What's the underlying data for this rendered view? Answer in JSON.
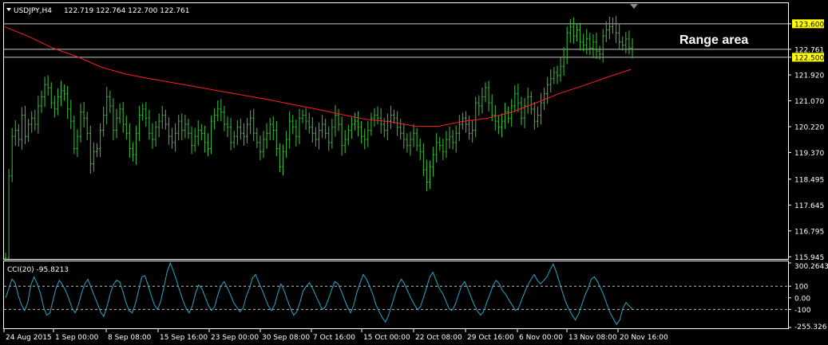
{
  "header": {
    "symbol_label": "USDJPY,H4",
    "ohlc": "122.719 122.764 122.700 122.761"
  },
  "cci_panel": {
    "label": "CCI(20) -95.8213"
  },
  "colors": {
    "background": "#000000",
    "candles": "#3fbf3f",
    "moving_average": "#ff2020",
    "cci": "#2aa7c9",
    "horizontal_lines": "#c8c8c8",
    "price_tag": "#ffff00",
    "current_price_tag": "#000000"
  },
  "chart_data": [
    {
      "type": "line",
      "title": "",
      "annotation": "Range area",
      "series": [
        {
          "name": "",
          "style": "candles",
          "values": [
            115.9,
            118.6,
            119.9,
            120.1,
            119.8,
            120.6,
            119.9,
            120.3,
            120.5,
            120.3,
            120.9,
            121.2,
            121.6,
            121.5,
            121.0,
            120.8,
            121.2,
            121.4,
            121.3,
            120.8,
            120.4,
            119.5,
            119.9,
            120.7,
            120.5,
            120.0,
            119.0,
            119.4,
            119.5,
            120.1,
            120.6,
            121.2,
            120.9,
            120.1,
            120.5,
            120.8,
            120.3,
            120.0,
            119.5,
            119.3,
            120.0,
            120.6,
            120.8,
            120.5,
            120.0,
            119.8,
            120.2,
            120.4,
            120.6,
            120.3,
            119.9,
            119.7,
            120.0,
            120.4,
            120.1,
            120.3,
            120.0,
            119.6,
            119.9,
            120.1,
            120.0,
            119.7,
            119.5,
            120.4,
            120.6,
            120.8,
            120.7,
            120.3,
            120.2,
            119.7,
            119.9,
            120.2,
            120.0,
            119.9,
            120.3,
            120.5,
            120.0,
            119.7,
            119.4,
            119.8,
            120.0,
            120.3,
            120.1,
            119.5,
            118.9,
            119.4,
            119.8,
            120.4,
            120.2,
            119.9,
            120.5,
            120.6,
            120.4,
            120.2,
            120.0,
            119.8,
            120.1,
            120.3,
            120.0,
            119.7,
            120.2,
            120.6,
            120.3,
            119.6,
            119.8,
            120.1,
            120.3,
            120.4,
            120.2,
            119.9,
            119.8,
            120.1,
            120.5,
            120.6,
            120.5,
            120.3,
            120.1,
            120.4,
            120.6,
            120.5,
            120.2,
            120.0,
            119.8,
            119.6,
            119.8,
            120.0,
            119.6,
            119.4,
            118.8,
            118.4,
            118.9,
            119.3,
            119.7,
            119.6,
            119.4,
            119.8,
            119.9,
            119.7,
            120.0,
            120.3,
            120.5,
            120.3,
            120.0,
            120.1,
            121.0,
            120.9,
            121.2,
            121.5,
            121.0,
            120.6,
            120.4,
            120.2,
            120.4,
            120.7,
            120.5,
            120.9,
            121.3,
            121.0,
            120.5,
            120.9,
            121.2,
            120.8,
            120.4,
            120.6,
            121.0,
            121.3,
            121.6,
            121.8,
            122.0,
            121.9,
            122.2,
            122.5,
            123.3,
            123.5,
            123.2,
            123.4,
            123.0,
            122.9,
            123.1,
            122.8,
            123.0,
            122.7,
            122.6,
            123.2,
            123.4,
            123.5,
            123.6,
            123.3,
            123.0,
            122.9,
            123.1,
            122.8,
            122.761
          ]
        },
        {
          "name": "",
          "style": "moving-average",
          "values": [
            123.5,
            123.18,
            122.8,
            122.52,
            122.18,
            121.95,
            121.8,
            121.66,
            121.52,
            121.38,
            121.24,
            121.1,
            120.94,
            120.79,
            120.62,
            120.46,
            120.38,
            120.24,
            120.23,
            120.39,
            120.49,
            120.68,
            120.98,
            121.3,
            121.56,
            121.84,
            122.1
          ]
        }
      ],
      "y_ticks": [
        "123.600",
        "122.761",
        "122.500",
        "121.920",
        "121.070",
        "120.220",
        "119.370",
        "118.495",
        "117.645",
        "116.795",
        "115.945"
      ],
      "ylim": [
        115.9,
        124.25
      ],
      "x_ticks": [
        "24 Aug 2015",
        "1 Sep 00:00",
        "8 Sep 08:00",
        "15 Sep 16:00",
        "23 Sep 00:00",
        "30 Sep 08:00",
        "7 Oct 16:00",
        "15 Oct 00:00",
        "22 Oct 08:00",
        "29 Oct 16:00",
        "6 Nov 00:00",
        "13 Nov 08:00",
        "20 Nov 16:00"
      ],
      "horizontal_lines": [
        123.6,
        122.761,
        122.5
      ],
      "grid": false
    },
    {
      "type": "line",
      "title": "",
      "series": [
        {
          "name": "",
          "values": [
            0,
            80,
            160,
            130,
            20,
            -60,
            -110,
            -40,
            110,
            180,
            120,
            40,
            -80,
            -150,
            -130,
            -20,
            90,
            150,
            110,
            60,
            -10,
            -90,
            -130,
            -60,
            40,
            120,
            160,
            90,
            20,
            -50,
            -120,
            -160,
            -80,
            30,
            110,
            150,
            140,
            60,
            -40,
            -110,
            -130,
            -50,
            60,
            180,
            190,
            110,
            20,
            -60,
            -100,
            -30,
            90,
            220,
            300,
            230,
            150,
            60,
            -20,
            -90,
            -130,
            -70,
            40,
            110,
            80,
            10,
            -60,
            -110,
            -80,
            20,
            100,
            140,
            90,
            30,
            -40,
            -80,
            -120,
            -90,
            10,
            80,
            170,
            200,
            130,
            70,
            0,
            -70,
            -110,
            -60,
            40,
            120,
            60,
            -20,
            -90,
            -150,
            -120,
            -40,
            60,
            100,
            130,
            80,
            20,
            -40,
            -100,
            -80,
            -10,
            70,
            140,
            120,
            60,
            -10,
            -80,
            -130,
            -60,
            50,
            130,
            200,
            160,
            100,
            30,
            -60,
            -120,
            -170,
            -210,
            -150,
            -60,
            30,
            110,
            160,
            120,
            60,
            0,
            -50,
            -100,
            -80,
            0,
            90,
            180,
            220,
            150,
            80,
            40,
            -20,
            -90,
            -110,
            -60,
            20,
            100,
            140,
            80,
            10,
            -60,
            -110,
            -150,
            -120,
            -40,
            30,
            110,
            150,
            120,
            60,
            30,
            -20,
            -60,
            -110,
            -90,
            -20,
            50,
            110,
            160,
            200,
            150,
            120,
            150,
            180,
            240,
            290,
            220,
            130,
            40,
            -40,
            -100,
            -150,
            -190,
            -140,
            -60,
            20,
            80,
            160,
            180,
            140,
            80,
            20,
            -60,
            -130,
            -180,
            -230,
            -190,
            -90,
            -40,
            -70,
            -95.8213
          ]
        }
      ],
      "y_ticks": [
        "300.2643",
        "100",
        "0.00",
        "-100",
        "-255.326"
      ],
      "ylim": [
        -255.326,
        300.2643
      ],
      "horizontal_lines": [
        100,
        -100
      ],
      "grid": false
    }
  ]
}
